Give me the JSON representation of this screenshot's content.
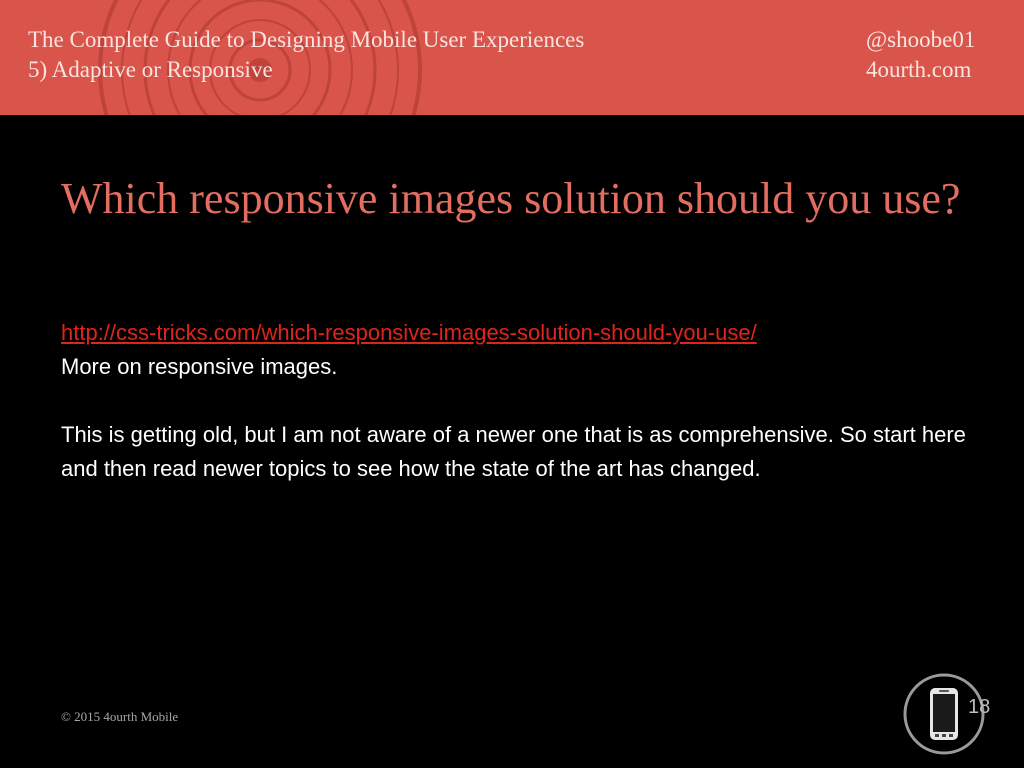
{
  "header": {
    "course_title": "The Complete Guide to Designing Mobile User Experiences",
    "section": "5) Adaptive or Responsive",
    "handle": "@shoobe01",
    "site": "4ourth.com",
    "accent_color": "#d9544a"
  },
  "slide": {
    "title": "Which responsive images solution should you use?",
    "link": "http://css-tricks.com/which-responsive-images-solution-should-you-use/",
    "link_caption": "More on responsive images.",
    "paragraph": "This is getting old, but I am not aware of a newer one that is as comprehensive. So start here and then read newer topics to see how the state of the art has changed.",
    "title_color": "#e36d60",
    "link_color": "#e0241b"
  },
  "footer": {
    "copyright": "© 2015 4ourth Mobile",
    "page_number": "18",
    "logo_icon": "mobile-phone-icon"
  }
}
